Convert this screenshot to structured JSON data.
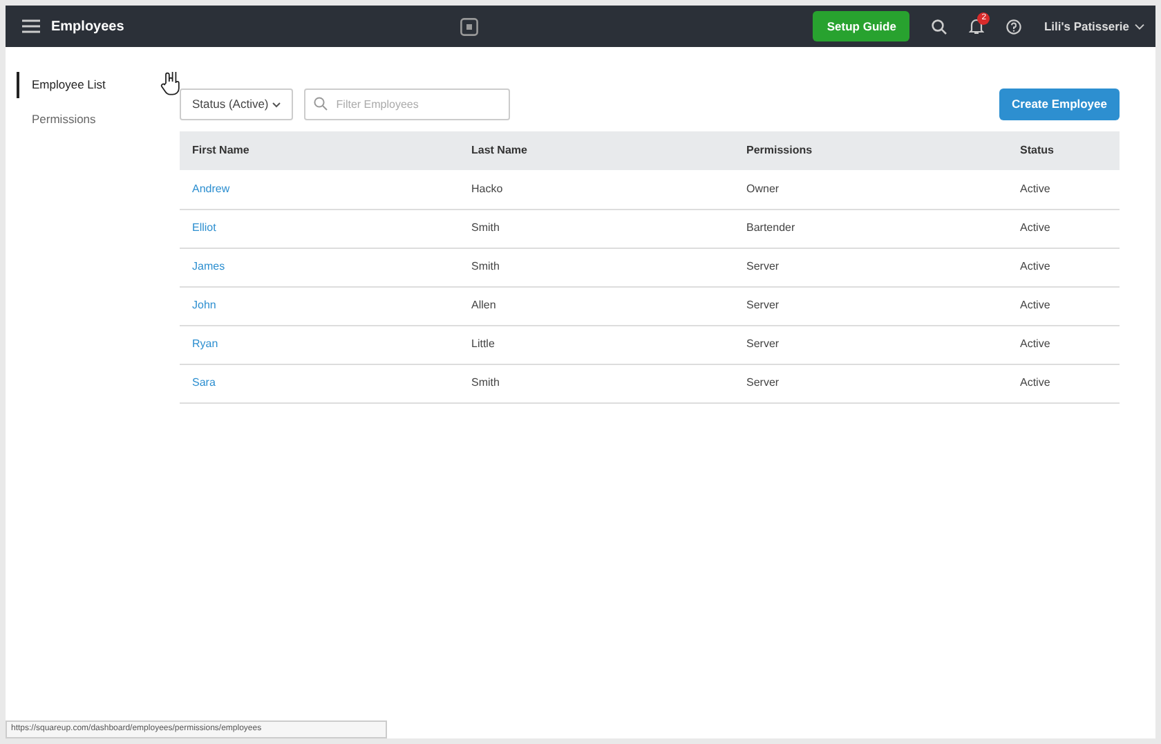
{
  "header": {
    "title": "Employees",
    "setup_button": "Setup Guide",
    "notification_count": "2",
    "account": "Lili's Patisserie"
  },
  "sidebar": {
    "items": [
      {
        "label": "Employee List",
        "selected": true
      },
      {
        "label": "Permissions",
        "selected": false
      }
    ]
  },
  "toolbar": {
    "status_filter": "Status (Active)",
    "search_placeholder": "Filter Employees",
    "create_button": "Create Employee"
  },
  "table": {
    "columns": [
      "First Name",
      "Last Name",
      "Permissions",
      "Status"
    ],
    "rows": [
      [
        "Andrew",
        "Hacko",
        "Owner",
        "Active"
      ],
      [
        "Elliot",
        "Smith",
        "Bartender",
        "Active"
      ],
      [
        "James",
        "Smith",
        "Server",
        "Active"
      ],
      [
        "John",
        "Allen",
        "Server",
        "Active"
      ],
      [
        "Ryan",
        "Little",
        "Server",
        "Active"
      ],
      [
        "Sara",
        "Smith",
        "Server",
        "Active"
      ]
    ]
  },
  "status_bar": {
    "url": "https://squareup.com/dashboard/employees/permissions/employees"
  }
}
